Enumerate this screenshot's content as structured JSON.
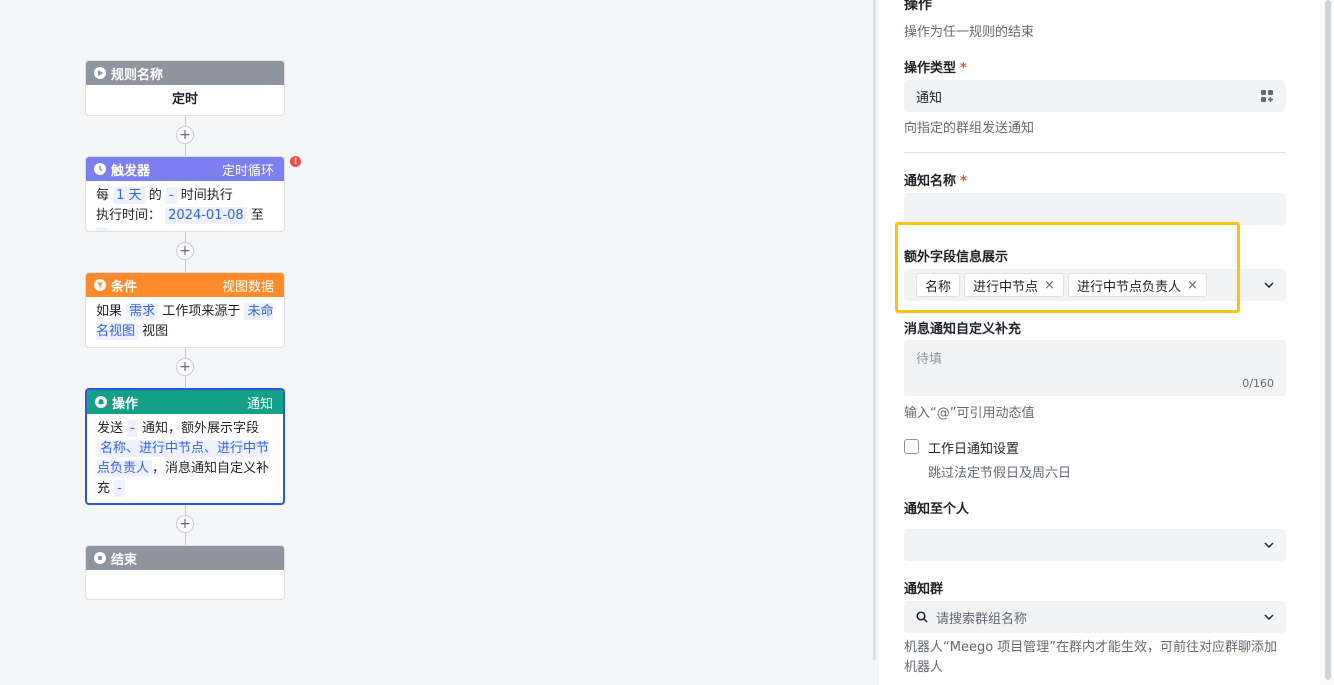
{
  "canvas": {
    "rule_node": {
      "title": "规则名称",
      "body": "定时"
    },
    "trigger_node": {
      "title": "触发器",
      "subtitle": "定时循环",
      "line1": [
        "每",
        "1 天",
        "的",
        "-",
        "时间执行"
      ],
      "line2": [
        "执行时间：",
        "2024-01-08",
        "至",
        "-"
      ],
      "color": "#7b7ff0"
    },
    "condition_node": {
      "title": "条件",
      "subtitle": "视图数据",
      "parts": [
        "如果",
        "需求",
        "工作项来源于",
        "未命名视图",
        "视图"
      ],
      "color": "#ff8a2a"
    },
    "action_node": {
      "title": "操作",
      "subtitle": "通知",
      "parts": [
        "发送",
        "-",
        "通知，额外展示字段",
        "名称、进行中节点、进行中节点负责人",
        "，消息通知自定义补充",
        "-"
      ],
      "color": "#14a087"
    },
    "end_node": {
      "title": "结束"
    },
    "plus": "+",
    "error_mark": "!"
  },
  "panel": {
    "section_title": "操作",
    "section_desc": "操作为任一规则的结束",
    "action_type": {
      "label": "操作类型",
      "required": "*",
      "value": "通知",
      "hint": "向指定的群组发送通知"
    },
    "notify_name": {
      "label": "通知名称",
      "required": "*",
      "value": ""
    },
    "extra_fields": {
      "label": "额外字段信息展示",
      "chips": [
        "名称",
        "进行中节点",
        "进行中节点负责人"
      ],
      "close": "×"
    },
    "custom_msg": {
      "label": "消息通知自定义补充",
      "placeholder": "待填",
      "counter": "0/160",
      "hint": "输入“@”可引用动态值"
    },
    "workday": {
      "label": "工作日通知设置",
      "hint": "跳过法定节假日及周六日"
    },
    "notify_person": {
      "label": "通知至个人",
      "value": ""
    },
    "notify_group": {
      "label": "通知群",
      "placeholder": "请搜索群组名称",
      "hint": "机器人“Meego 项目管理”在群内才能生效，可前往对应群聊添加机器人"
    }
  }
}
